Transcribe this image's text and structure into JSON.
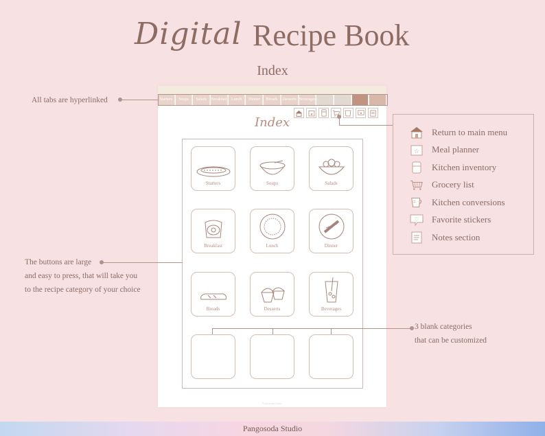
{
  "header": {
    "title_script": "Digital",
    "title_main": "Recipe Book",
    "subtitle": "Index"
  },
  "page": {
    "tabs": [
      "Starters",
      "Soups",
      "Salads",
      "Breakfast",
      "Lunch",
      "Dinner",
      "Breads",
      "Desserts",
      "Beverages",
      "",
      "",
      "",
      ""
    ],
    "heading": "Index",
    "watermark": "Pangosoda Studio",
    "categories": [
      "Starters",
      "Soups",
      "Salads",
      "Breakfast",
      "Lunch",
      "Dinner",
      "Breads",
      "Desserts",
      "Beverages",
      "",
      "",
      ""
    ]
  },
  "notes": {
    "tabs_note": "All tabs are hyperlinked",
    "buttons_note_1": "The buttons are large",
    "buttons_note_2": "and easy to press, that will take you",
    "buttons_note_3": "to the recipe category of your choice",
    "blank_note_1": "3 blank categories",
    "blank_note_2": "that can be customized"
  },
  "legend": {
    "items": [
      {
        "icon": "house-icon",
        "label": "Return to main menu"
      },
      {
        "icon": "calendar-star-icon",
        "label": "Meal planner"
      },
      {
        "icon": "fridge-icon",
        "label": "Kitchen inventory"
      },
      {
        "icon": "cart-icon",
        "label": "Grocery list"
      },
      {
        "icon": "measuring-cup-icon",
        "label": "Kitchen conversions"
      },
      {
        "icon": "heart-sticker-icon",
        "label": "Favorite stickers"
      },
      {
        "icon": "note-icon",
        "label": "Notes section"
      }
    ]
  },
  "footer": {
    "brand": "Pangosoda Studio"
  },
  "colors": {
    "background": "#f7e1e3",
    "accent": "#8c6c63",
    "tab": "#e8d2c9",
    "tab_dark": "#c09383"
  }
}
